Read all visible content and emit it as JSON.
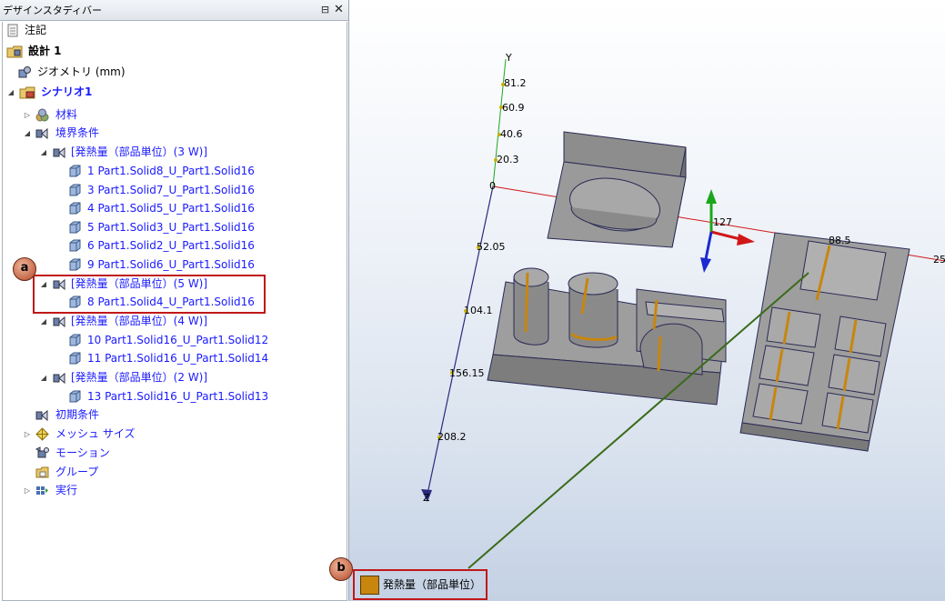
{
  "panel": {
    "title": "デザインスタディバー",
    "pin_glyph": "⊟",
    "close_glyph": "✕"
  },
  "tree": [
    {
      "label": "注記",
      "icon": "note-icon"
    },
    {
      "label": "設計 1",
      "icon": "design-icon"
    },
    {
      "label": "ジオメトリ (mm)",
      "icon": "geometry-icon"
    },
    {
      "label": "シナリオ1",
      "icon": "scenario-icon"
    },
    {
      "label": "材料",
      "icon": "materials-icon"
    },
    {
      "label": "境界条件",
      "icon": "boundary-conditions-icon"
    },
    {
      "label": "[発熱量（部品単位）(3 W)]",
      "icon": "heat-source-icon"
    },
    {
      "label": "1 Part1.Solid8_U_Part1.Solid16",
      "icon": "solid-icon"
    },
    {
      "label": "3 Part1.Solid7_U_Part1.Solid16",
      "icon": "solid-icon"
    },
    {
      "label": "4 Part1.Solid5_U_Part1.Solid16",
      "icon": "solid-icon"
    },
    {
      "label": "5 Part1.Solid3_U_Part1.Solid16",
      "icon": "solid-icon"
    },
    {
      "label": "6 Part1.Solid2_U_Part1.Solid16",
      "icon": "solid-icon"
    },
    {
      "label": "9 Part1.Solid6_U_Part1.Solid16",
      "icon": "solid-icon"
    },
    {
      "label": "[発熱量（部品単位）(5 W)]",
      "icon": "heat-source-icon"
    },
    {
      "label": "8 Part1.Solid4_U_Part1.Solid16",
      "icon": "solid-icon"
    },
    {
      "label": "[発熱量（部品単位）(4 W)]",
      "icon": "heat-source-icon"
    },
    {
      "label": "10 Part1.Solid16_U_Part1.Solid12",
      "icon": "solid-icon"
    },
    {
      "label": "11 Part1.Solid16_U_Part1.Solid14",
      "icon": "solid-icon"
    },
    {
      "label": "[発熱量（部品単位）(2 W)]",
      "icon": "heat-source-icon"
    },
    {
      "label": "13 Part1.Solid16_U_Part1.Solid13",
      "icon": "solid-icon"
    },
    {
      "label": "初期条件",
      "icon": "initial-conditions-icon"
    },
    {
      "label": "メッシュ サイズ",
      "icon": "mesh-size-icon"
    },
    {
      "label": "モーション",
      "icon": "motion-icon"
    },
    {
      "label": "グループ",
      "icon": "group-icon"
    },
    {
      "label": "実行",
      "icon": "run-icon"
    }
  ],
  "callouts": {
    "a": "a",
    "b": "b"
  },
  "viewport": {
    "axis_y_label": "Y",
    "axis_z_label": "Z",
    "y_ticks": [
      "81.2",
      "60.9",
      "40.6",
      "20.3",
      "0"
    ],
    "z_ticks": [
      "52.05",
      "104.1",
      "156.15",
      "208.2"
    ],
    "x_ticks": [
      "127",
      "25"
    ],
    "x_partial_tick": "88.5"
  },
  "legend": {
    "label": "発熱量（部品単位）",
    "swatch_color": "#c8860e"
  },
  "colors": {
    "tree_link": "#1a1aff",
    "highlight": "#c01818",
    "leader_line": "#3a6b1a",
    "part_fill": "#8f8f8f",
    "heat_strip": "#c8860e"
  }
}
